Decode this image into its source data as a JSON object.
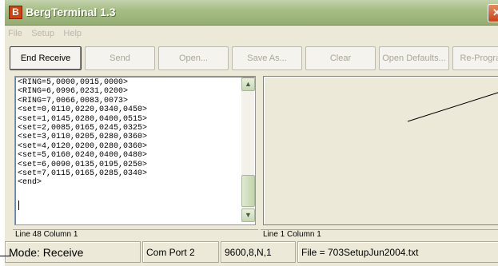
{
  "window": {
    "title": "BergTerminal 1.3",
    "icon_letter": "B"
  },
  "menu": [
    "File",
    "Setup",
    "Help"
  ],
  "toolbar": [
    {
      "label": "End Receive",
      "enabled": true
    },
    {
      "label": "Send",
      "enabled": false
    },
    {
      "label": "Open...",
      "enabled": false
    },
    {
      "label": "Save As...",
      "enabled": false
    },
    {
      "label": "Clear",
      "enabled": false
    },
    {
      "label": "Open Defaults...",
      "enabled": false
    },
    {
      "label": "Re-Program...",
      "enabled": false
    }
  ],
  "log": {
    "lines": [
      "<RING=5,0000,0915,0000>",
      "<RING=6,0996,0231,0200>",
      "<RING=7,0066,0083,0073>",
      "<set=0,0110,0220,0340,0450>",
      "<set=1,0145,0280,0400,0515>",
      "<set=2,0085,0165,0245,0325>",
      "<set=3,0110,0205,0280,0360>",
      "<set=4,0120,0200,0280,0360>",
      "<set=5,0160,0240,0400,0480>",
      "<set=6,0090,0135,0195,0250>",
      "<set=7,0115,0165,0285,0340>",
      "<end>"
    ]
  },
  "left_status": "Line 48 Column 1",
  "right_status": "Line 1 Column 1",
  "statusbar": {
    "mode": "Mode: Receive",
    "port": "Com Port 2",
    "settings": "9600,8,N,1",
    "file": "File = 703SetupJun2004.txt"
  },
  "colors": {
    "titlebar": "#a7bd86",
    "face": "#ece9d8",
    "accent_red": "#d43f12"
  }
}
